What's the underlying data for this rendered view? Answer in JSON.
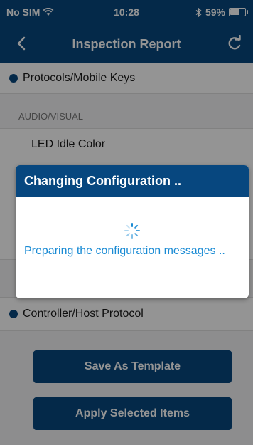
{
  "status_bar": {
    "carrier": "No SIM",
    "time": "10:28",
    "battery": "59%",
    "battery_level": 0.59
  },
  "nav": {
    "title": "Inspection Report"
  },
  "list": {
    "protocols_label": "Protocols/Mobile Keys",
    "section_audio_visual": "AUDIO/VISUAL",
    "led_idle_color": "LED Idle Color",
    "controller_label": "Controller/Host Protocol"
  },
  "buttons": {
    "save_template": "Save As Template",
    "apply_selected": "Apply Selected Items"
  },
  "dialog": {
    "title": "Changing Configuration ..",
    "message": "Preparing the configuration messages .."
  },
  "colors": {
    "primary": "#07477f",
    "message_text": "#1a8bd4",
    "background": "#f3f3f5"
  }
}
